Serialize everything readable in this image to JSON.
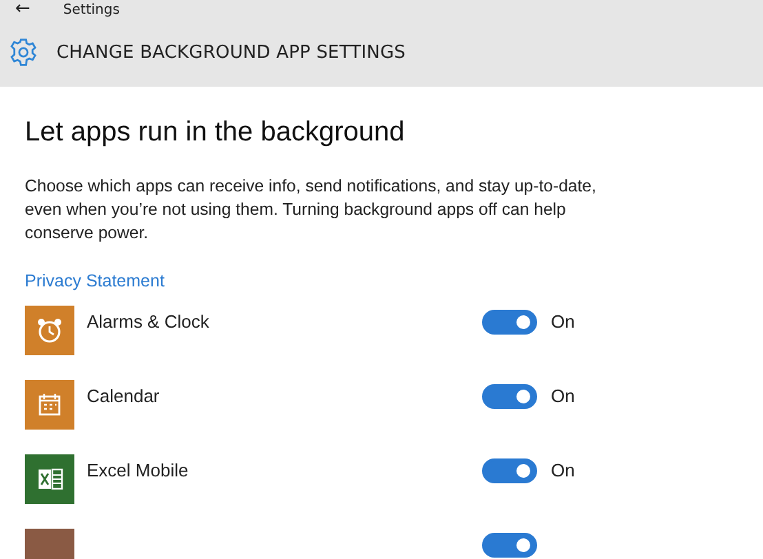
{
  "window": {
    "back": "←",
    "title": "Settings"
  },
  "header": {
    "title": "CHANGE BACKGROUND APP SETTINGS"
  },
  "heading": "Let apps run in the background",
  "description": "Choose which apps can receive info, send notifications, and stay up-to-date, even when you’re not using them. Turning background apps off can help conserve power.",
  "link": "Privacy Statement",
  "apps": [
    {
      "name": "Alarms & Clock",
      "kind": "alarm",
      "color": "#d0802a",
      "on": true,
      "state": "On"
    },
    {
      "name": "Calendar",
      "kind": "calendar",
      "color": "#d0802a",
      "on": true,
      "state": "On"
    },
    {
      "name": "Excel Mobile",
      "kind": "excel",
      "color": "#2f7030",
      "on": true,
      "state": "On"
    },
    {
      "kind": "blank",
      "color": "#8a5a44",
      "on": true
    }
  ]
}
